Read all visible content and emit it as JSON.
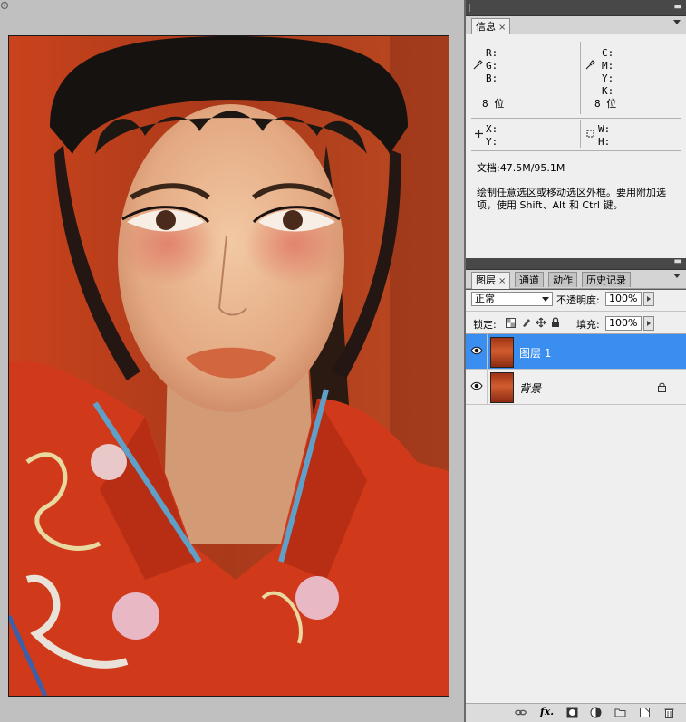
{
  "info_panel": {
    "tab_label": "信息",
    "close_glyph": "×",
    "rgb_labels": [
      "R:",
      "G:",
      "B:"
    ],
    "rgb_bits": "8 位",
    "cmyk_labels": [
      "C:",
      "M:",
      "Y:",
      "K:"
    ],
    "cmyk_bits": "8 位",
    "xy_labels": [
      "X:",
      "Y:"
    ],
    "wh_labels": [
      "W:",
      "H:"
    ],
    "doc_size": "文档:47.5M/95.1M",
    "hint_line1": "绘制任意选区或移动选区外框。要用附加选",
    "hint_line2": "项，使用 Shift、Alt 和 Ctrl 键。"
  },
  "layers_panel": {
    "tabs": [
      {
        "label": "图层",
        "close": "×"
      },
      {
        "label": "通道"
      },
      {
        "label": "动作"
      },
      {
        "label": "历史记录"
      }
    ],
    "blend_mode": "正常",
    "opacity_label": "不透明度:",
    "opacity_value": "100%",
    "lock_label": "锁定:",
    "fill_label": "填充:",
    "fill_value": "100%",
    "layers": [
      {
        "name": "图层 1",
        "selected": true
      },
      {
        "name": "背景",
        "selected": false,
        "locked": true
      }
    ],
    "bottom_icons": [
      "link-icon",
      "fx-icon",
      "mask-icon",
      "adjustment-icon",
      "folder-icon",
      "new-layer-icon",
      "trash-icon"
    ],
    "fx_label": "fx."
  },
  "colors": {
    "selection_blue": "#3a8ef0",
    "panel_bg": "#efefef",
    "workspace_bg": "#c0c0c0"
  }
}
